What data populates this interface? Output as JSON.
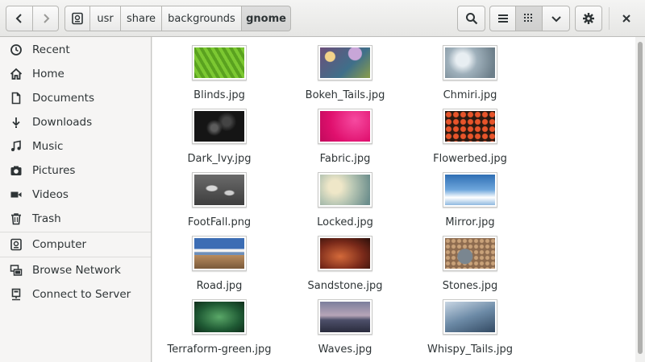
{
  "header": {
    "path": [
      {
        "label": ""
      },
      {
        "label": "usr"
      },
      {
        "label": "share"
      },
      {
        "label": "backgrounds"
      },
      {
        "label": "gnome",
        "active": true
      }
    ],
    "icons": {
      "back": "chevron-left-icon",
      "forward": "chevron-right-icon",
      "root": "drive-icon",
      "search": "search-icon",
      "list_view": "list-view-icon",
      "grid_view": "grid-view-icon",
      "view_menu": "chevron-down-icon",
      "settings": "gear-icon",
      "close": "close-icon"
    }
  },
  "sidebar": {
    "items": [
      {
        "label": "Recent",
        "icon": "clock-icon"
      },
      {
        "label": "Home",
        "icon": "home-icon"
      },
      {
        "label": "Documents",
        "icon": "document-icon"
      },
      {
        "label": "Downloads",
        "icon": "download-icon"
      },
      {
        "label": "Music",
        "icon": "music-icon"
      },
      {
        "label": "Pictures",
        "icon": "camera-icon"
      },
      {
        "label": "Videos",
        "icon": "video-icon"
      },
      {
        "label": "Trash",
        "icon": "trash-icon"
      },
      {
        "label": "Computer",
        "icon": "drive-icon"
      },
      {
        "label": "Browse Network",
        "icon": "network-icon"
      },
      {
        "label": "Connect to Server",
        "icon": "server-icon"
      }
    ]
  },
  "files": [
    {
      "name": "Blinds.jpg"
    },
    {
      "name": "Bokeh_Tails.jpg"
    },
    {
      "name": "Chmiri.jpg"
    },
    {
      "name": "Dark_Ivy.jpg"
    },
    {
      "name": "Fabric.jpg"
    },
    {
      "name": "Flowerbed.jpg"
    },
    {
      "name": "FootFall.png"
    },
    {
      "name": "Locked.jpg"
    },
    {
      "name": "Mirror.jpg"
    },
    {
      "name": "Road.jpg"
    },
    {
      "name": "Sandstone.jpg"
    },
    {
      "name": "Stones.jpg"
    },
    {
      "name": "Terraform-green.jpg"
    },
    {
      "name": "Waves.jpg"
    },
    {
      "name": "Whispy_Tails.jpg"
    }
  ]
}
